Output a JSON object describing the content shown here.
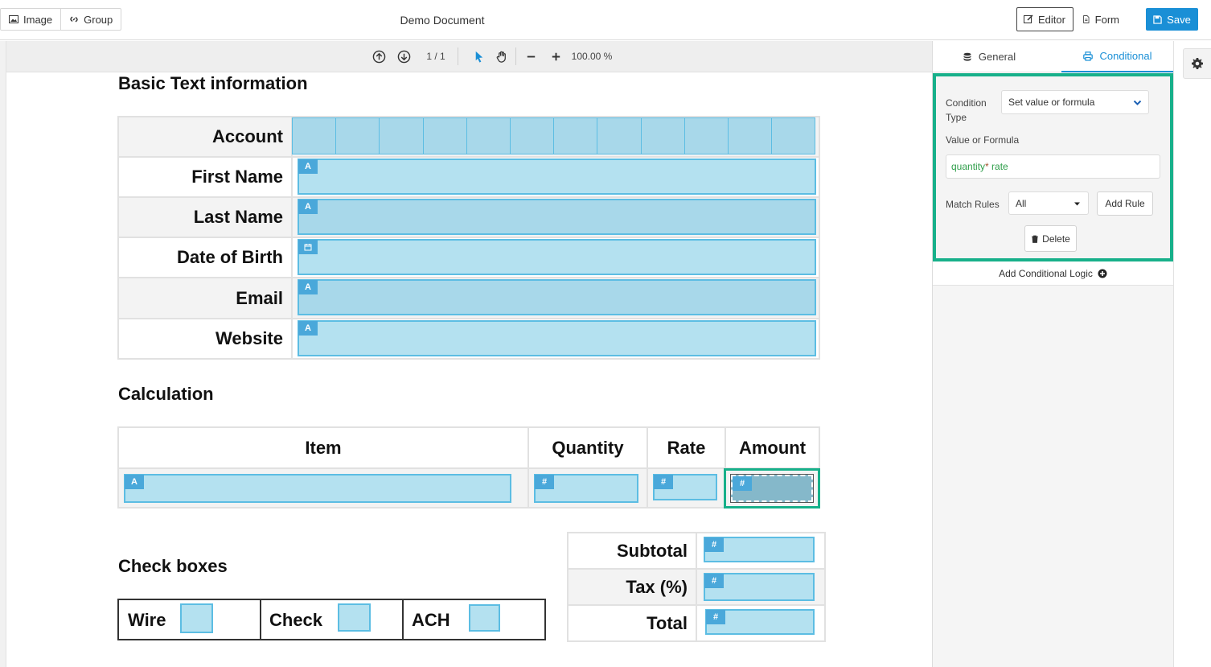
{
  "topbar": {
    "image_label": "Image",
    "group_label": "Group",
    "document_title": "Demo Document",
    "editor_label": "Editor",
    "form_label": "Form",
    "save_label": "Save"
  },
  "viewer": {
    "page_counter": "1 / 1",
    "zoom": "100.00 %"
  },
  "document": {
    "basic_heading": "Basic Text information",
    "basic_rows": [
      {
        "label": "Account",
        "type": "account"
      },
      {
        "label": "First Name",
        "type": "text",
        "tag": "A"
      },
      {
        "label": "Last Name",
        "type": "text",
        "tag": "A"
      },
      {
        "label": "Date of Birth",
        "type": "date",
        "tag": "calendar"
      },
      {
        "label": "Email",
        "type": "text",
        "tag": "A"
      },
      {
        "label": "Website",
        "type": "text",
        "tag": "A"
      }
    ],
    "calc_heading": "Calculation",
    "calc_headers": [
      "Item",
      "Quantity",
      "Rate",
      "Amount"
    ],
    "calc_tags": [
      "A",
      "#",
      "#",
      "#"
    ],
    "totals": [
      {
        "label": "Subtotal",
        "tag": "#"
      },
      {
        "label": "Tax (%)",
        "tag": "#"
      },
      {
        "label": "Total",
        "tag": "#"
      }
    ],
    "check_heading": "Check boxes",
    "checkboxes": [
      "Wire",
      "Check",
      "ACH"
    ]
  },
  "panel": {
    "tab_general": "General",
    "tab_conditional": "Conditional",
    "condition_type_label": "Condition Type",
    "condition_type_value": "Set value or formula",
    "value_formula_label": "Value or Formula",
    "formula_var1": "quantity",
    "formula_op": "*",
    "formula_var2": "rate",
    "match_rules_label": "Match Rules",
    "match_rules_value": "All",
    "add_rule_label": "Add Rule",
    "delete_label": "Delete",
    "add_conditional_logic": "Add Conditional Logic"
  },
  "colors": {
    "accent": "#1a8fd6",
    "selection": "#17b08a",
    "field_fill": "#b4e1f0",
    "field_border": "#5cbde3",
    "tag_fill": "#4aa8da"
  }
}
